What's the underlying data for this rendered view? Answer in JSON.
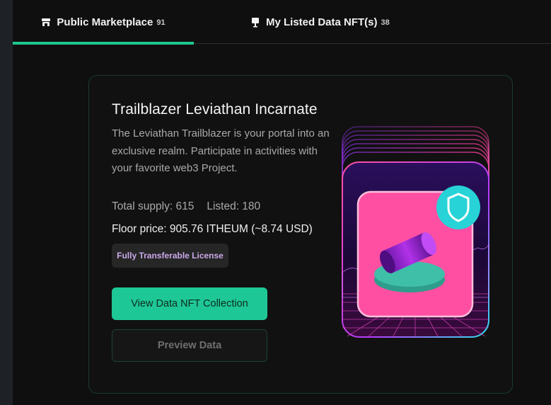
{
  "tabs": [
    {
      "label": "Public Marketplace",
      "count": "91",
      "icon": "store-icon",
      "active": true
    },
    {
      "label": "My Listed Data NFT(s)",
      "count": "38",
      "icon": "sign-icon",
      "active": false
    }
  ],
  "card": {
    "title": "Trailblazer Leviathan Incarnate",
    "description": "The Leviathan Trailblazer is your portal into an exclusive realm. Participate in activities with your favorite web3 Project.",
    "total_supply": "Total supply: 615",
    "listed": "Listed: 180",
    "floor_price": "Floor price: 905.76 ITHEUM (~8.74 USD)",
    "badge": "Fully Transferable License",
    "primary_button": "View Data NFT Collection",
    "secondary_button": "Preview Data"
  },
  "colors": {
    "accent": "#1ec78e",
    "background": "#0f0f0f",
    "badge_text": "#c9a9ea",
    "art_pink": "#ff4fa3",
    "art_purple": "#9b1fd1",
    "art_teal": "#3fbfa8",
    "art_shield": "#27d3d6"
  },
  "icons": {
    "shield": "shield-icon"
  }
}
